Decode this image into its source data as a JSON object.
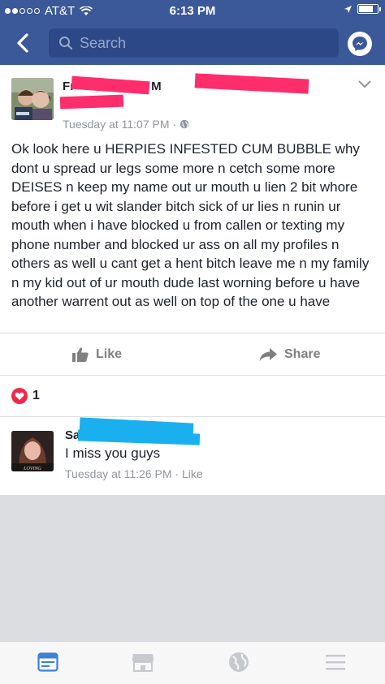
{
  "status_bar": {
    "carrier": "AT&T",
    "time": "6:13 PM"
  },
  "header": {
    "search_placeholder": "Search"
  },
  "post": {
    "author_visible": "Fr",
    "author_suffix": "with M",
    "timestamp": "Tuesday at 11:07 PM",
    "body": "Ok look here u HERPIES INFESTED CUM BUBBLE why dont u spread ur legs some more n cetch some more DEISES n keep my name out ur mouth u lien 2 bit whore before i get u wit slander bitch sick of ur lies n runin ur mouth when i have blocked u from callen or texting my phone number and blocked ur ass on all my profiles n others as well u cant get a hent bitch leave me n my family n my kid out of ur mouth dude last worning before u have another warrent out as well on top of the one u have",
    "like_label": "Like",
    "share_label": "Share",
    "reaction_count": "1"
  },
  "comment": {
    "author_visible": "Sa",
    "text": "I miss you guys",
    "meta": "Tuesday at 11:26 PM · Like",
    "avatar_caption": "LOVING"
  },
  "colors": {
    "header_bg": "#3b5998",
    "redaction_pink": "#ff2d6b",
    "redaction_blue": "#1ab0f0",
    "love_red": "#f0284a"
  },
  "icons": {
    "back": "chevron-left-icon",
    "search": "search-icon",
    "messenger": "messenger-icon",
    "more": "chevron-down-icon",
    "globe": "globe-icon",
    "like": "thumbs-up-icon",
    "share": "share-arrow-icon",
    "love": "heart-icon",
    "tab_feed": "news-feed-icon",
    "tab_marketplace": "marketplace-icon",
    "tab_notifications": "globe-icon",
    "tab_menu": "menu-icon"
  }
}
